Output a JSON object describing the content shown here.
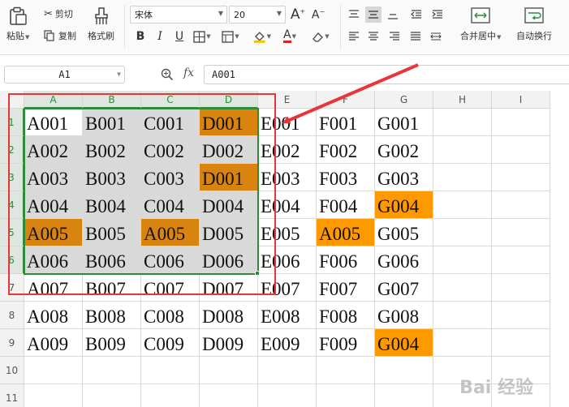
{
  "ribbon": {
    "paste_label": "粘贴",
    "cut_label": "剪切",
    "copy_label": "复制",
    "format_painter_label": "格式刷",
    "font_name": "宋体",
    "font_size": "20",
    "bold": "B",
    "italic": "I",
    "underline": "U",
    "merge_center_label": "合并居中",
    "auto_wrap_label": "自动换行"
  },
  "formula_bar": {
    "name_box": "A1",
    "fx": "fx",
    "formula": "A001"
  },
  "columns": [
    "A",
    "B",
    "C",
    "D",
    "E",
    "F",
    "G",
    "H",
    "I"
  ],
  "rows": [
    "1",
    "2",
    "3",
    "4",
    "5",
    "6",
    "7",
    "8",
    "9",
    "10",
    "11"
  ],
  "cells": [
    [
      "A001",
      "B001",
      "C001",
      "D001",
      "E001",
      "F001",
      "G001"
    ],
    [
      "A002",
      "B002",
      "C002",
      "D002",
      "E002",
      "F002",
      "G002"
    ],
    [
      "A003",
      "B003",
      "C003",
      "D001",
      "E003",
      "F003",
      "G003"
    ],
    [
      "A004",
      "B004",
      "C004",
      "D004",
      "E004",
      "F004",
      "G004"
    ],
    [
      "A005",
      "B005",
      "A005",
      "D005",
      "E005",
      "A005",
      "G005"
    ],
    [
      "A006",
      "B006",
      "C006",
      "D006",
      "E006",
      "F006",
      "G006"
    ],
    [
      "A007",
      "B007",
      "C007",
      "D007",
      "E007",
      "F007",
      "G007"
    ],
    [
      "A008",
      "B008",
      "C008",
      "D008",
      "E008",
      "F008",
      "G008"
    ],
    [
      "A009",
      "B009",
      "C009",
      "D009",
      "E009",
      "F009",
      "G004"
    ]
  ],
  "highlight_color": "#ff9900",
  "selected_highlight_color": "#d9840f",
  "selection_fill": "#d9d9d9",
  "annotation_color": "#e8353a",
  "watermark": "Bai 经验"
}
